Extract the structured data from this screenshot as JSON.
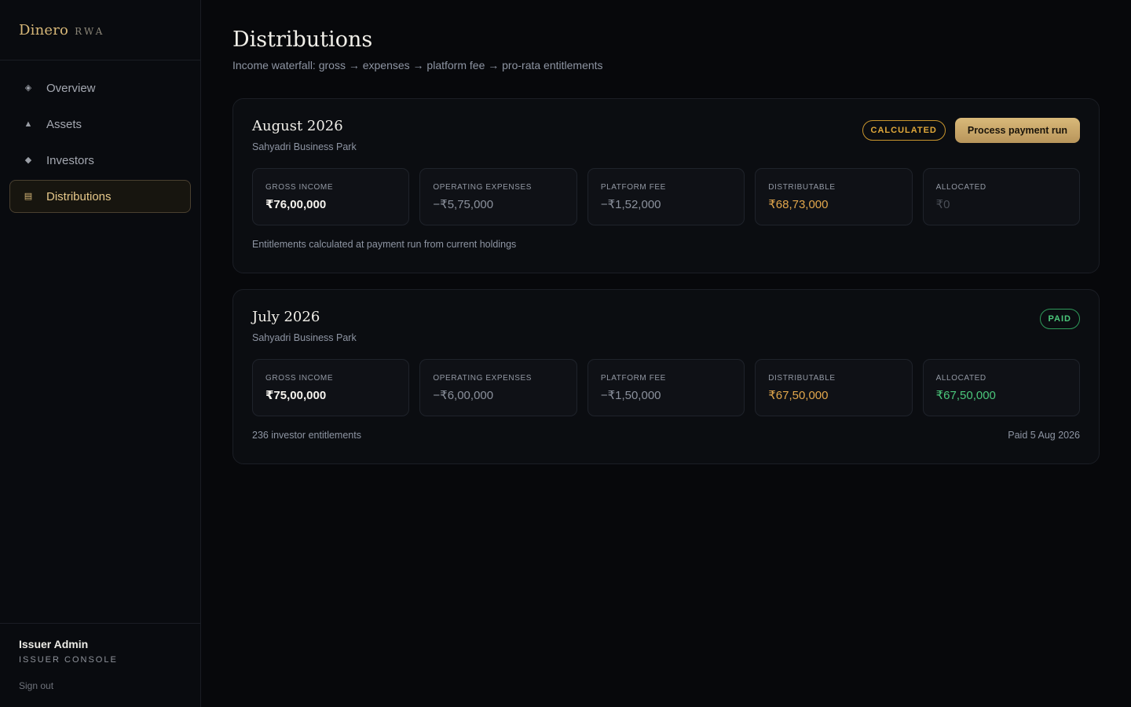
{
  "brand": {
    "name": "Dinero",
    "sub": "RWA"
  },
  "nav": [
    {
      "label": "Overview",
      "icon": "diamond-outline-icon",
      "glyph": "◈",
      "active": false
    },
    {
      "label": "Assets",
      "icon": "triangle-icon",
      "glyph": "▲",
      "active": false
    },
    {
      "label": "Investors",
      "icon": "diamond-icon",
      "glyph": "◆",
      "active": false
    },
    {
      "label": "Distributions",
      "icon": "ledger-icon",
      "glyph": "▤",
      "active": true
    }
  ],
  "user": {
    "name": "Issuer Admin",
    "role": "ISSUER CONSOLE",
    "signout": "Sign out"
  },
  "page": {
    "title": "Distributions",
    "subtitle": "Income waterfall: gross → expenses → platform fee → pro-rata entitlements"
  },
  "distributions": [
    {
      "period": "August 2026",
      "asset": "Sahyadri Business Park",
      "status": "CALCULATED",
      "action": "Process payment run",
      "metrics": {
        "gross_label": "GROSS INCOME",
        "gross": "₹76,00,000",
        "opex_label": "OPERATING EXPENSES",
        "opex": "−₹5,75,000",
        "fee_label": "PLATFORM FEE",
        "fee": "−₹1,52,000",
        "dist_label": "DISTRIBUTABLE",
        "dist": "₹68,73,000",
        "alloc_label": "ALLOCATED",
        "alloc": "₹0"
      },
      "footer_left": "Entitlements calculated at payment run from current holdings",
      "footer_right": ""
    },
    {
      "period": "July 2026",
      "asset": "Sahyadri Business Park",
      "status": "PAID",
      "metrics": {
        "gross_label": "GROSS INCOME",
        "gross": "₹75,00,000",
        "opex_label": "OPERATING EXPENSES",
        "opex": "−₹6,00,000",
        "fee_label": "PLATFORM FEE",
        "fee": "−₹1,50,000",
        "dist_label": "DISTRIBUTABLE",
        "dist": "₹67,50,000",
        "alloc_label": "ALLOCATED",
        "alloc": "₹67,50,000"
      },
      "footer_left": "236 investor entitlements",
      "footer_right": "Paid 5 Aug 2026"
    }
  ],
  "colors": {
    "accent_gold": "#d8b878",
    "status_calculated": "#e0a83a",
    "status_paid": "#4bc77b",
    "background": "#07080b"
  }
}
